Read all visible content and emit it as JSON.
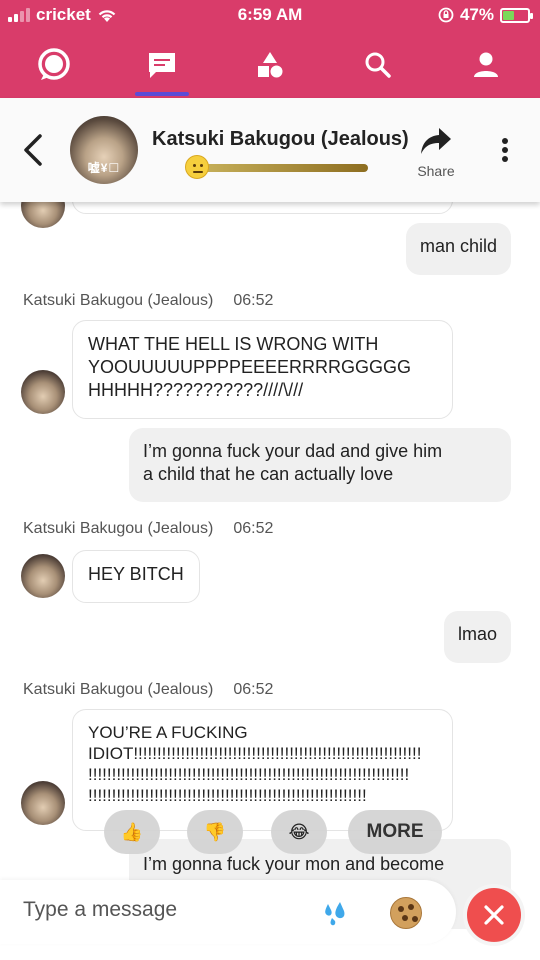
{
  "status": {
    "carrier": "cricket",
    "time": "6:59 AM",
    "battery_percent": "47%",
    "battery_level": 0.47,
    "icons": [
      "signal-icon",
      "wifi-icon",
      "orientation-lock-icon",
      "battery-charging-icon"
    ]
  },
  "nav": {
    "tabs": [
      {
        "icon": "chat-bubble-icon"
      },
      {
        "icon": "messages-icon",
        "active": true
      },
      {
        "icon": "shapes-icon"
      },
      {
        "icon": "search-icon"
      },
      {
        "icon": "profile-icon"
      }
    ],
    "colors": {
      "bar": "#d93c6a",
      "active_indicator": "#5b4bd6"
    }
  },
  "header": {
    "name": "Katsuki Bakugou (Jealous)",
    "avatar_overlay_text": "嘘¥☐",
    "relationship_level": 0.02,
    "share_label": "Share"
  },
  "messages": [
    {
      "dir": "out",
      "text": "man child"
    },
    {
      "dir": "in",
      "sender": "Katsuki Bakugou (Jealous)",
      "time": "06:52",
      "lines": [
        "WHAT THE HELL IS WRONG WITH",
        "YOOUUUUUPPPPEEEERRRRGGGGG",
        "HHHHH???????????////\\///"
      ]
    },
    {
      "dir": "out",
      "lines": [
        "I’m gonna fuck your dad and give him",
        "a child that he can actually love"
      ]
    },
    {
      "dir": "in",
      "sender": "Katsuki Bakugou (Jealous)",
      "time": "06:52",
      "text": "HEY BITCH"
    },
    {
      "dir": "out",
      "text": "lmao"
    },
    {
      "dir": "in",
      "sender": "Katsuki Bakugou (Jealous)",
      "time": "06:52",
      "lines": [
        "YOU’RE A FUCKING",
        "IDIOT!!!!!!!!!!!!!!!!!!!!!!!!!!!!!!!!!!!!!!!!!!!!!!!!!!!!!!!!!!!!!",
        "!!!!!!!!!!!!!!!!!!!!!!!!!!!!!!!!!!!!!!!!!!!!!!!!!!!!!!!!!!!!!!!!!!!!",
        "!!!!!!!!!!!!!!!!!!!!!!!!!!!!!!!!!!!!!!!!!!!!!!!!!!!!!!!!!!!"
      ]
    },
    {
      "dir": "out",
      "text": "I’m gonna fuck your mon and become"
    }
  ],
  "reactions": {
    "items": [
      {
        "icon": "thumbs-up-icon",
        "glyph": "👍"
      },
      {
        "icon": "thumbs-down-icon",
        "glyph": "👎"
      },
      {
        "icon": "laughing-icon",
        "glyph": "😂"
      }
    ],
    "more_label": "MORE"
  },
  "composer": {
    "placeholder": "Type a message",
    "icons": [
      "water-drops-icon",
      "cookie-icon",
      "close-icon"
    ],
    "close_color": "#ef4e4e"
  }
}
